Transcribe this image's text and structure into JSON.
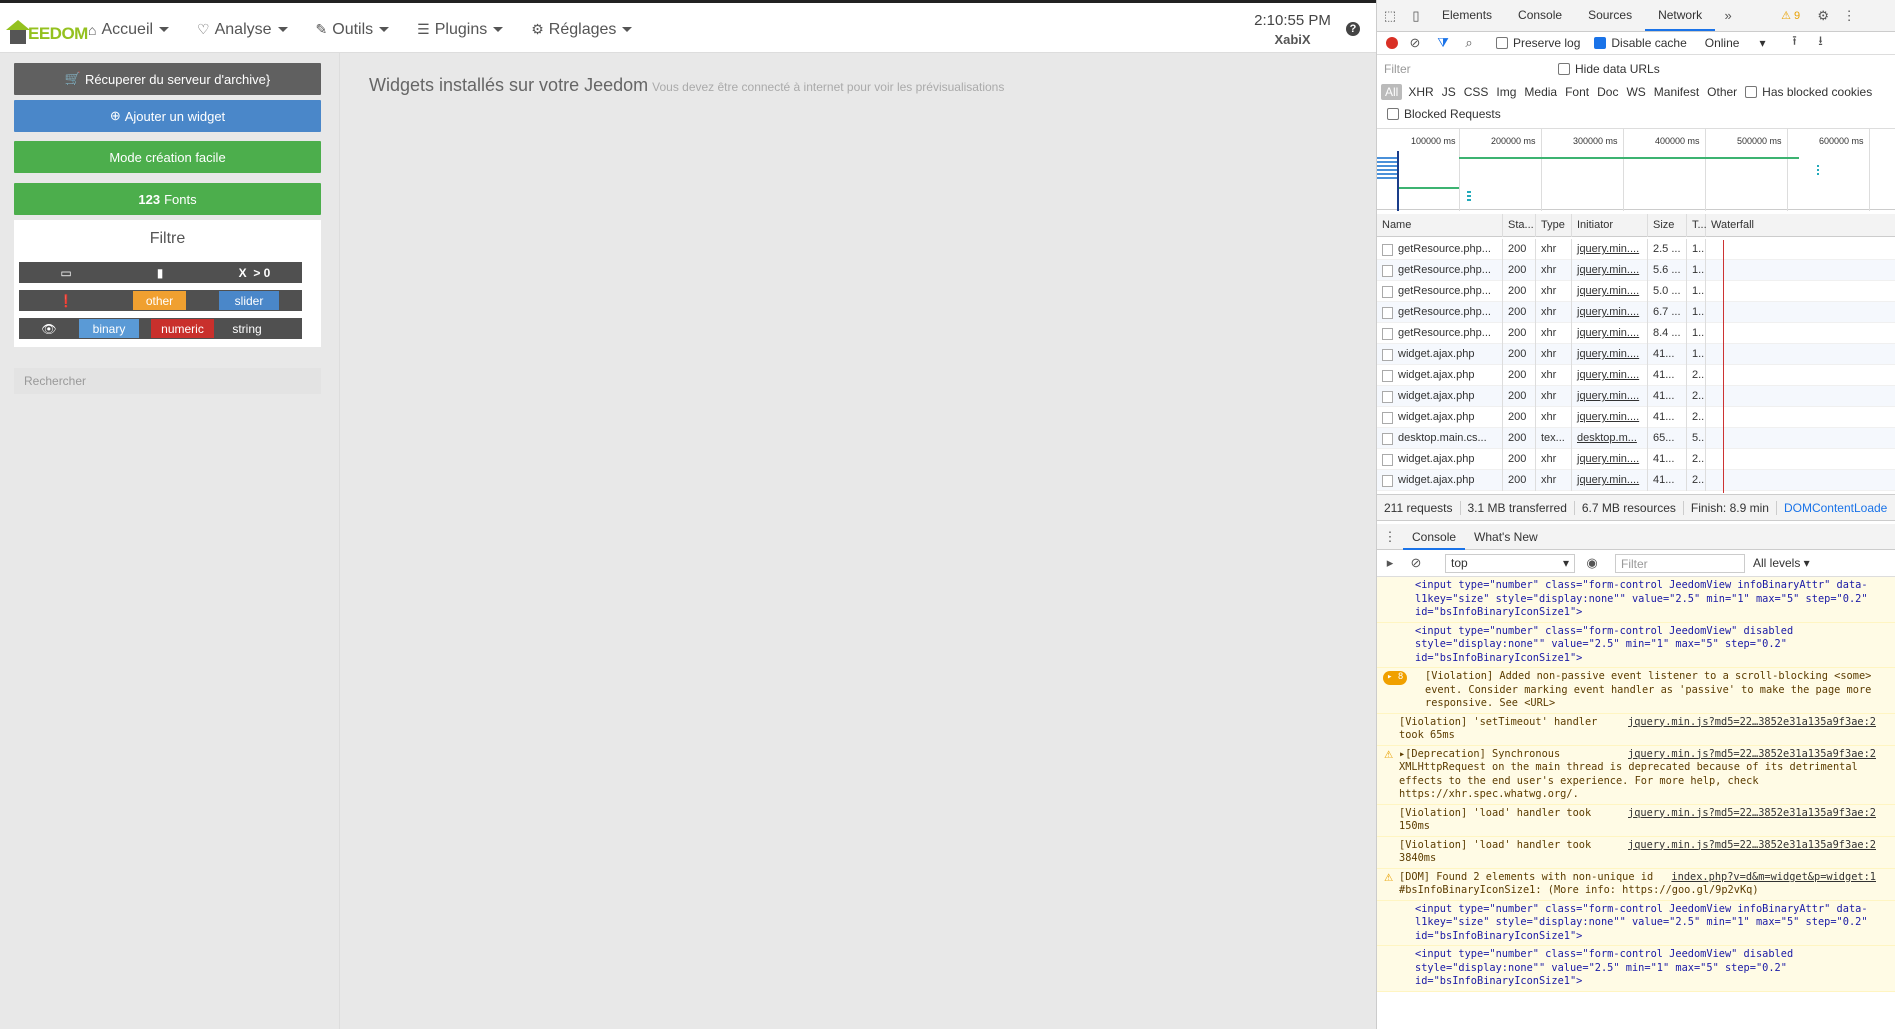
{
  "header": {
    "logo_text": "EEDOM",
    "menu": [
      {
        "icon": "home-icon",
        "glyph": "⌂",
        "label": "Accueil"
      },
      {
        "icon": "stethoscope-icon",
        "glyph": "♡",
        "label": "Analyse"
      },
      {
        "icon": "wrench-icon",
        "glyph": "✎",
        "label": "Outils"
      },
      {
        "icon": "list-icon",
        "glyph": "☰",
        "label": "Plugins"
      },
      {
        "icon": "gear-icon",
        "glyph": "⚙",
        "label": "Réglages"
      }
    ],
    "time": "2:10:55 PM",
    "user": "XabiX",
    "help_glyph": "?"
  },
  "sidebar": {
    "btn_archive": "Récuperer du serveur d'archive}",
    "btn_add": "Ajouter un widget",
    "btn_easy": "Mode création facile",
    "btn_fonts": "Fonts",
    "filter_title": "Filtre",
    "filter_row1": {
      "x_label": "X",
      "gt0": "> 0"
    },
    "filter_row2": {
      "other": "other",
      "slider": "slider"
    },
    "filter_row3": {
      "binary": "binary",
      "numeric": "numeric",
      "string": "string"
    },
    "search_placeholder": "Rechercher"
  },
  "main": {
    "title": "Widgets installés sur votre Jeedom",
    "subtitle": "Vous devez être connecté à internet pour voir les prévisualisations"
  },
  "devtools": {
    "tabs": [
      "Elements",
      "Console",
      "Sources",
      "Network"
    ],
    "more": "»",
    "warn_count": "⚠ 9",
    "toolbar": {
      "preserve_log": "Preserve log",
      "disable_cache": "Disable cache",
      "throttle": "Online"
    },
    "filter_placeholder": "Filter",
    "hide_data_urls": "Hide data URLs",
    "types": [
      "All",
      "XHR",
      "JS",
      "CSS",
      "Img",
      "Media",
      "Font",
      "Doc",
      "WS",
      "Manifest",
      "Other"
    ],
    "has_blocked": "Has blocked cookies",
    "blocked_requests": "Blocked Requests",
    "ticks": [
      "100000 ms",
      "200000 ms",
      "300000 ms",
      "400000 ms",
      "500000 ms",
      "600000 ms"
    ],
    "columns": [
      "Name",
      "Sta...",
      "Type",
      "Initiator",
      "Size",
      "T...",
      "Waterfall"
    ],
    "rows": [
      {
        "name": "getResource.php...",
        "status": "200",
        "type": "xhr",
        "initiator": "jquery.min....",
        "size": "2.5 ...",
        "time": "1..."
      },
      {
        "name": "getResource.php...",
        "status": "200",
        "type": "xhr",
        "initiator": "jquery.min....",
        "size": "5.6 ...",
        "time": "1..."
      },
      {
        "name": "getResource.php...",
        "status": "200",
        "type": "xhr",
        "initiator": "jquery.min....",
        "size": "5.0 ...",
        "time": "1..."
      },
      {
        "name": "getResource.php...",
        "status": "200",
        "type": "xhr",
        "initiator": "jquery.min....",
        "size": "6.7 ...",
        "time": "1..."
      },
      {
        "name": "getResource.php...",
        "status": "200",
        "type": "xhr",
        "initiator": "jquery.min....",
        "size": "8.4 ...",
        "time": "1..."
      },
      {
        "name": "widget.ajax.php",
        "status": "200",
        "type": "xhr",
        "initiator": "jquery.min....",
        "size": "41...",
        "time": "1..."
      },
      {
        "name": "widget.ajax.php",
        "status": "200",
        "type": "xhr",
        "initiator": "jquery.min....",
        "size": "41...",
        "time": "2..."
      },
      {
        "name": "widget.ajax.php",
        "status": "200",
        "type": "xhr",
        "initiator": "jquery.min....",
        "size": "41...",
        "time": "2..."
      },
      {
        "name": "widget.ajax.php",
        "status": "200",
        "type": "xhr",
        "initiator": "jquery.min....",
        "size": "41...",
        "time": "2..."
      },
      {
        "name": "desktop.main.cs...",
        "status": "200",
        "type": "tex...",
        "initiator": "desktop.m...",
        "size": "65...",
        "time": "5..."
      },
      {
        "name": "widget.ajax.php",
        "status": "200",
        "type": "xhr",
        "initiator": "jquery.min....",
        "size": "41...",
        "time": "2..."
      },
      {
        "name": "widget.ajax.php",
        "status": "200",
        "type": "xhr",
        "initiator": "jquery.min....",
        "size": "41...",
        "time": "2..."
      }
    ],
    "summary": [
      "211 requests",
      "3.1 MB transferred",
      "6.7 MB resources",
      "Finish: 8.9 min",
      "DOMContentLoade"
    ],
    "console_tabs": [
      "Console",
      "What's New"
    ],
    "context": "top",
    "console_filter": "Filter",
    "levels": "All levels ▾",
    "messages": [
      {
        "kind": "code",
        "text": "<input type=\"number\" class=\"form-control JeedomView infoBinaryAttr\" data-l1key=\"size\" style=\"display:none\"\" value=\"2.5\" min=\"1\" max=\"5\" step=\"0.2\" id=\"bsInfoBinaryIconSize1\">"
      },
      {
        "kind": "code",
        "text": "<input type=\"number\" class=\"form-control JeedomView\" disabled style=\"display:none\"\" value=\"2.5\" min=\"1\" max=\"5\" step=\"0.2\" id=\"bsInfoBinaryIconSize1\">"
      },
      {
        "kind": "viol",
        "count": "▸ 8",
        "text": "[Violation] Added non-passive event listener to a scroll-blocking <some> event. Consider marking event handler as 'passive' to make the page more responsive. See <URL>"
      },
      {
        "kind": "plain",
        "src": "jquery.min.js?md5=22…3852e31a135a9f3ae:2",
        "text": "[Violation] 'setTimeout' handler took 65ms"
      },
      {
        "kind": "warn",
        "src": "jquery.min.js?md5=22…3852e31a135a9f3ae:2",
        "text": "▸[Deprecation] Synchronous XMLHttpRequest on the main thread is deprecated because of its detrimental effects to the end user's experience. For more help, check https://xhr.spec.whatwg.org/."
      },
      {
        "kind": "plain",
        "src": "jquery.min.js?md5=22…3852e31a135a9f3ae:2",
        "text": "[Violation] 'load' handler took 150ms"
      },
      {
        "kind": "plain",
        "src": "jquery.min.js?md5=22…3852e31a135a9f3ae:2",
        "text": "[Violation] 'load' handler took 3840ms"
      },
      {
        "kind": "warn",
        "src": "index.php?v=d&m=widget&p=widget:1",
        "text": "[DOM] Found 2 elements with non-unique id #bsInfoBinaryIconSize1: (More info: https://goo.gl/9p2vKq)"
      },
      {
        "kind": "code",
        "text": "<input type=\"number\" class=\"form-control JeedomView infoBinaryAttr\" data-l1key=\"size\" style=\"display:none\"\" value=\"2.5\" min=\"1\" max=\"5\" step=\"0.2\" id=\"bsInfoBinaryIconSize1\">"
      },
      {
        "kind": "code",
        "text": "<input type=\"number\" class=\"form-control JeedomView\" disabled style=\"display:none\"\" value=\"2.5\" min=\"1\" max=\"5\" step=\"0.2\" id=\"bsInfoBinaryIconSize1\">"
      }
    ]
  },
  "colors": {
    "accent_green": "#4cae4c",
    "accent_blue": "#4a87c9",
    "other_orange": "#f0a030",
    "numeric_red": "#c9302c"
  }
}
